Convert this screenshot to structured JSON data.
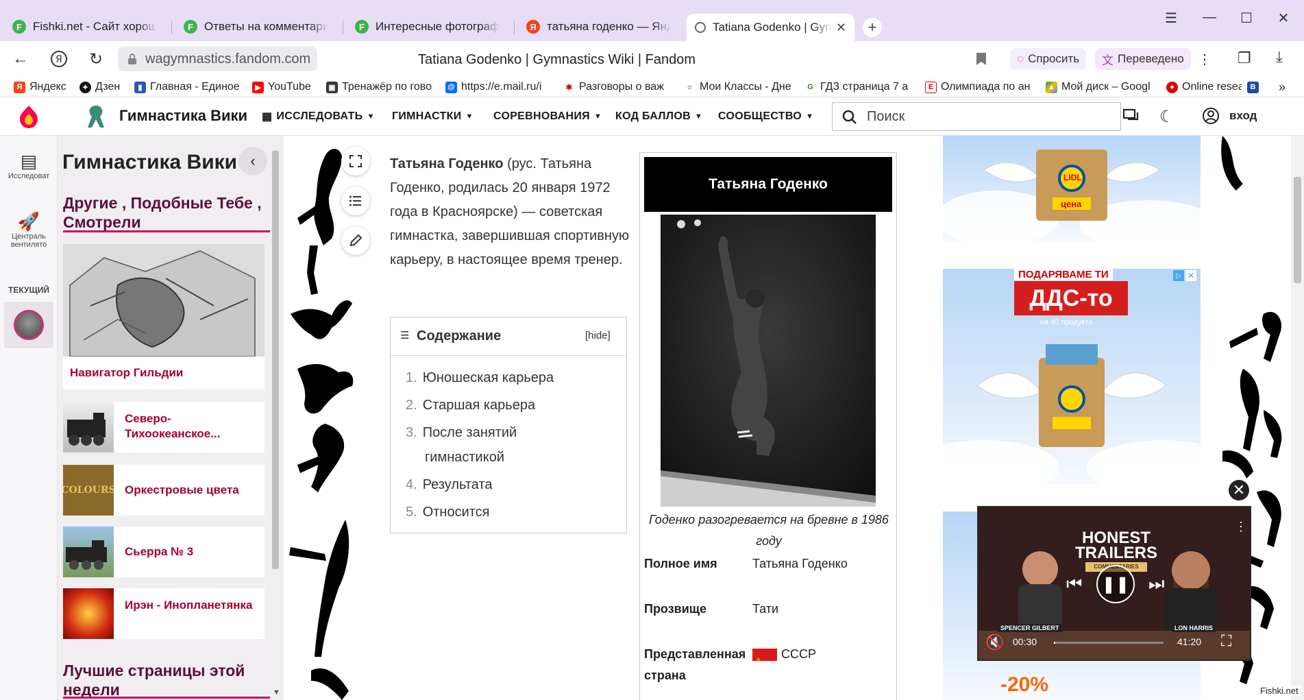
{
  "browser": {
    "tabs": [
      {
        "title": "Fishki.net - Сайт хорошего настроения",
        "icon": "F"
      },
      {
        "title": "Ответы на комментарии",
        "icon": "F"
      },
      {
        "title": "Интересные фотографии",
        "icon": "F"
      },
      {
        "title": "татьяна годенко — Яндекс",
        "icon": "Я"
      },
      {
        "title": "Tatiana Godenko | Gymnastics Wiki",
        "icon": ""
      }
    ],
    "address": {
      "url": "wagymnastics.fandom.com",
      "page_title": "Tatiana Godenko | Gymnastics Wiki | Fandom",
      "ask_label": "Спросить",
      "translated_label": "Переведено"
    },
    "bookmarks": [
      {
        "label": "Яндекс"
      },
      {
        "label": "Дзен"
      },
      {
        "label": "Главная - Единое"
      },
      {
        "label": "YouTube"
      },
      {
        "label": "Тренажёр по гово"
      },
      {
        "label": "https://e.mail.ru/i"
      },
      {
        "label": "Разговоры о важ"
      },
      {
        "label": "Мои Классы - Дне"
      },
      {
        "label": "ГДЗ страница 7 а"
      },
      {
        "label": "Олимпиада по ан"
      },
      {
        "label": "Мой диск – Googl"
      },
      {
        "label": "Online resear"
      }
    ]
  },
  "wiki": {
    "name": "Гимнастика Вики",
    "nav": [
      "ИССЛЕДОВАТЬ",
      "ГИМНАСТКИ",
      "СОРЕВНОВАНИЯ",
      "КОД БАЛЛОВ",
      "СООБЩЕСТВО"
    ],
    "search_placeholder": "Поиск",
    "login_label": "вход"
  },
  "rail": {
    "explore_label": "Исследоват",
    "central_label": "Централь вентилято",
    "current_label": "ТЕКУЩИЙ"
  },
  "left_panel": {
    "title": "Гимнастика Вики",
    "section1": "Другие , Подобные Тебе , Смотрели",
    "featured_label": "Навигатор Гильдии",
    "items": [
      {
        "label": "Северо-Тихоокеанское..."
      },
      {
        "label": "Оркестровые цвета",
        "thumb_text": "COLOURS"
      },
      {
        "label": "Сьерра № 3"
      },
      {
        "label": "Ирэн - Инопланетянка"
      }
    ],
    "section2": "Лучшие страницы этой недели"
  },
  "article": {
    "intro_bold": "Татьяна Годенко",
    "intro_rest": " (рус. Татьяна Годенко, родилась 20 января 1972 года в Красноярске) — советская гимнастка, завершившая спортивную карьеру, в настоящее время тренер.",
    "toc_title": "Содержание",
    "toc_hide": "hide",
    "toc": [
      {
        "n": "1.",
        "text": "Юношеская карьера"
      },
      {
        "n": "2.",
        "text": "Старшая карьера"
      },
      {
        "n": "3.",
        "text": "После занятий гимнастикой"
      },
      {
        "n": "4.",
        "text": "Результата"
      },
      {
        "n": "5.",
        "text": "Относится"
      }
    ]
  },
  "infobox": {
    "title": "Татьяна Годенко",
    "caption": "Годенко разогревается на бревне в 1986 году",
    "rows": [
      {
        "key": "Полное имя",
        "value": "Татьяна Годенко"
      },
      {
        "key": "Прозвище",
        "value": "Тати"
      },
      {
        "key": "Представленная страна",
        "value": "СССР"
      }
    ]
  },
  "ads": {
    "brand": "LIDL",
    "bag_text": "цена",
    "headline_top": "ПОДАРЯВАМЕ ТИ",
    "headline_main": "ДДС-то",
    "headline_sub": "на 40 продукта",
    "discount": "-20%"
  },
  "video": {
    "show_title": "HONEST TRAILERS",
    "show_sub": "COMMENTARIES",
    "person_left": "SPENCER GILBERT",
    "person_right": "LON HARRIS",
    "time_current": "00:30",
    "time_total": "41:20",
    "progress": 0.012
  },
  "watermark": "Fishki.net",
  "colors": {
    "tabbar": "#e7ddf7",
    "fandom_accent": "#d4005f",
    "heading": "#5b0f3b",
    "link": "#a3002f"
  }
}
